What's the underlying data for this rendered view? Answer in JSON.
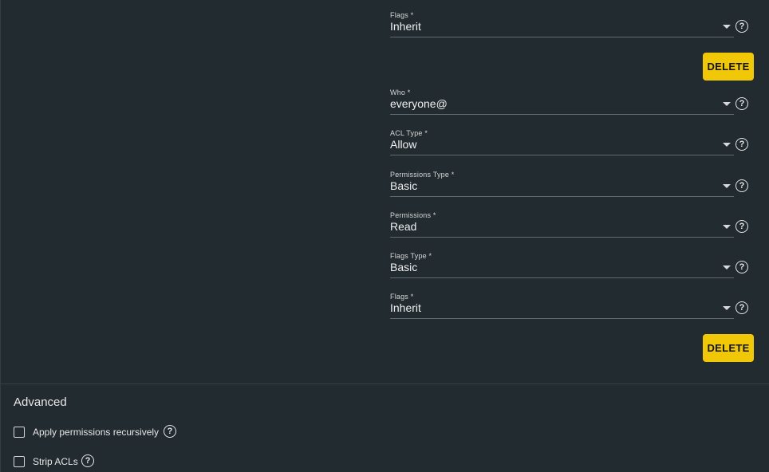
{
  "entries": [
    {
      "fields": [
        {
          "label": "Flags *",
          "value": "Inherit"
        }
      ],
      "delete_label": "DELETE"
    },
    {
      "fields": [
        {
          "label": "Who *",
          "value": "everyone@"
        },
        {
          "label": "ACL Type *",
          "value": "Allow"
        },
        {
          "label": "Permissions Type *",
          "value": "Basic"
        },
        {
          "label": "Permissions *",
          "value": "Read"
        },
        {
          "label": "Flags Type *",
          "value": "Basic"
        },
        {
          "label": "Flags *",
          "value": "Inherit"
        }
      ],
      "delete_label": "DELETE"
    }
  ],
  "advanced": {
    "title": "Advanced",
    "options": [
      {
        "label": "Apply permissions recursively",
        "checked": false
      },
      {
        "label": "Strip ACLs",
        "checked": false
      }
    ]
  },
  "icons": {
    "help": "help-circle-icon",
    "dropdown": "chevron-down-icon",
    "help_glyph": "?"
  },
  "colors": {
    "background": "#222b30",
    "accent_button": "#f0c808"
  }
}
